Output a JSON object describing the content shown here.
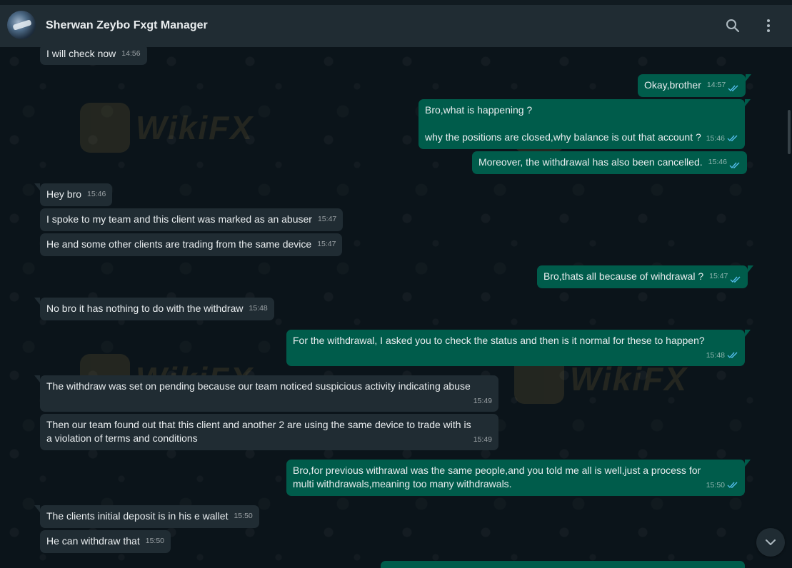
{
  "header": {
    "contact_name": "Sherwan Zeybo Fxgt Manager"
  },
  "watermark": {
    "text": "WikiFX"
  },
  "messages": [
    {
      "dir": "in",
      "text": "I will check now",
      "time": "14:56"
    },
    {
      "dir": "out",
      "text": "Okay,brother",
      "time": "14:57"
    },
    {
      "dir": "out",
      "text": "Bro,what is happening ?\n\nwhy the positions are closed,why balance is out that account ?",
      "time": "15:46"
    },
    {
      "dir": "out",
      "text": "Moreover, the withdrawal has also been cancelled.",
      "time": "15:46"
    },
    {
      "dir": "in",
      "text": "Hey bro",
      "time": "15:46"
    },
    {
      "dir": "in",
      "text": "I spoke to my team and this client was marked as an abuser",
      "time": "15:47"
    },
    {
      "dir": "in",
      "text": "He and some other clients are trading from the same device",
      "time": "15:47"
    },
    {
      "dir": "out",
      "text": "Bro,thats all because of wihdrawal ?",
      "time": "15:47"
    },
    {
      "dir": "in",
      "text": "No bro it has nothing to do with the withdraw",
      "time": "15:48"
    },
    {
      "dir": "out",
      "text": "For the withdrawal, I asked you to check the status and then is it normal for these to happen?",
      "time": "15:48"
    },
    {
      "dir": "in",
      "text": "The withdraw was set on pending because our team noticed suspicious activity indicating abuse",
      "time": "15:49"
    },
    {
      "dir": "in",
      "text": "Then our team found out that this client and another 2 are using the same device to trade with is a violation of terms and conditions",
      "time": "15:49"
    },
    {
      "dir": "out",
      "text": "Bro,for previous withrawal was the same people,and you told me all is well,just a process for multi withdrawals,meaning too many withdrawals.",
      "time": "15:50"
    },
    {
      "dir": "in",
      "text": "The clients initial deposit is in his e wallet",
      "time": "15:50"
    },
    {
      "dir": "in",
      "text": "He can withdraw that",
      "time": "15:50"
    }
  ],
  "colors": {
    "incoming": "#202c33",
    "outgoing": "#005c4b",
    "read_ticks": "#53bdeb",
    "background": "#0b141a"
  },
  "icons": {
    "search": "search-icon",
    "menu": "more-vert-icon",
    "scroll": "chevron-down-icon",
    "read": "double-check-icon"
  }
}
